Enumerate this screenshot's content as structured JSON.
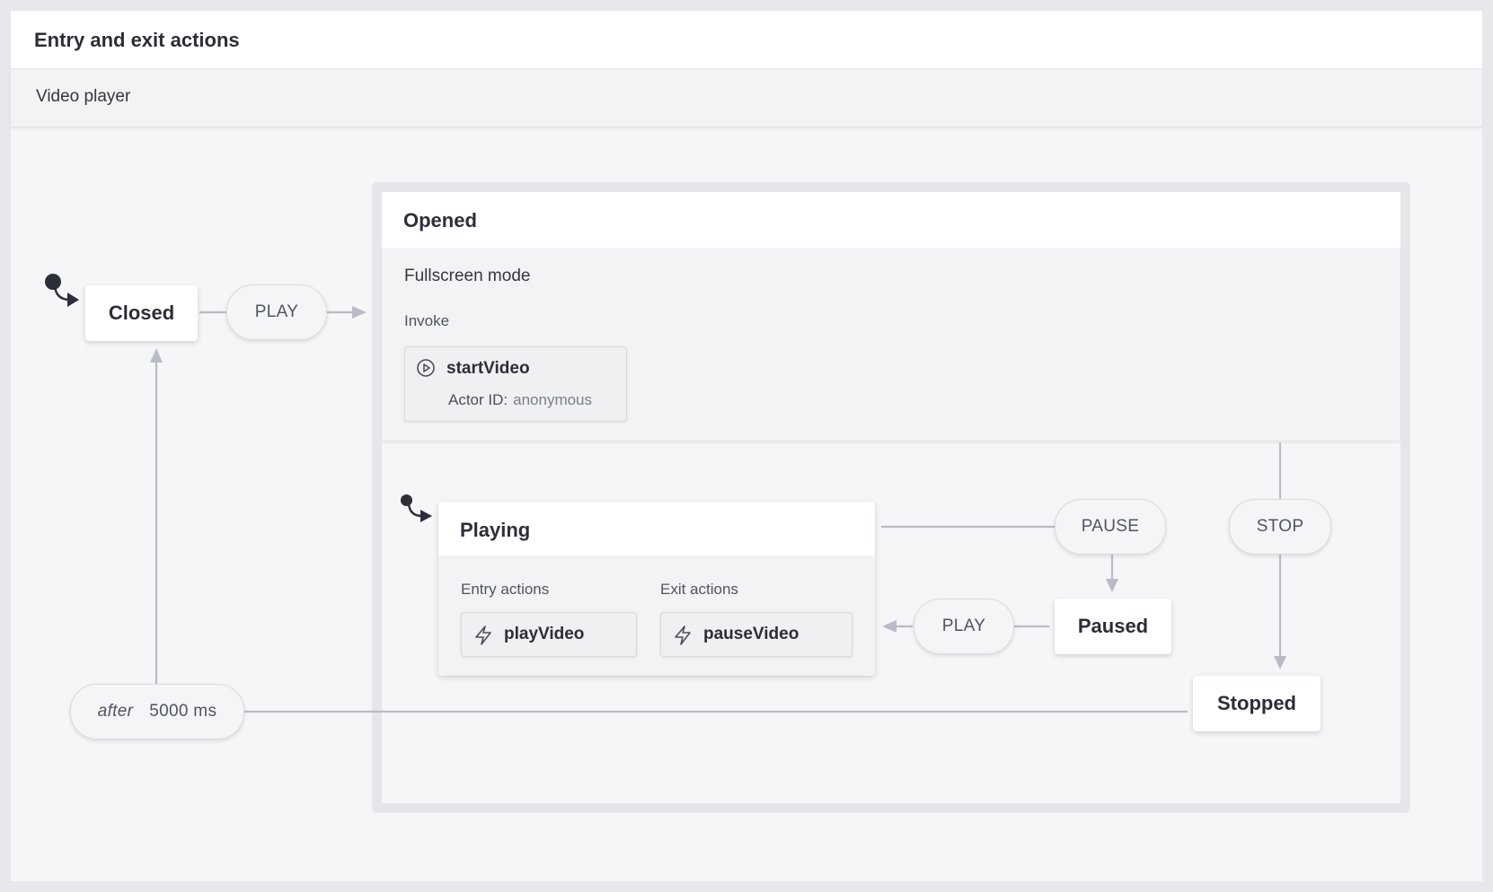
{
  "header": {
    "title": "Entry and exit actions"
  },
  "machine": {
    "description": "Video player"
  },
  "states": {
    "closed": "Closed",
    "opened": {
      "title": "Opened",
      "description": "Fullscreen mode",
      "invoke_label": "Invoke",
      "invoke": {
        "name": "startVideo",
        "actor_label": "Actor ID:",
        "actor_value": "anonymous"
      }
    },
    "playing": {
      "title": "Playing",
      "entry_label": "Entry actions",
      "exit_label": "Exit actions",
      "entry_action": "playVideo",
      "exit_action": "pauseVideo"
    },
    "paused": "Paused",
    "stopped": "Stopped"
  },
  "events": {
    "play_open": "PLAY",
    "pause": "PAUSE",
    "play_resume": "PLAY",
    "stop": "STOP",
    "after_keyword": "after",
    "after_delay": "5000 ms"
  },
  "colors": {
    "edge": "#b9bcc6",
    "node_bg": "#ffffff",
    "canvas_bg": "#f4f6f7",
    "text_dark": "#2b2e38"
  },
  "icons": {
    "invoke": "play-circle-icon",
    "action": "lightning-bolt-icon",
    "initial": "initial-state-arrow-icon"
  }
}
